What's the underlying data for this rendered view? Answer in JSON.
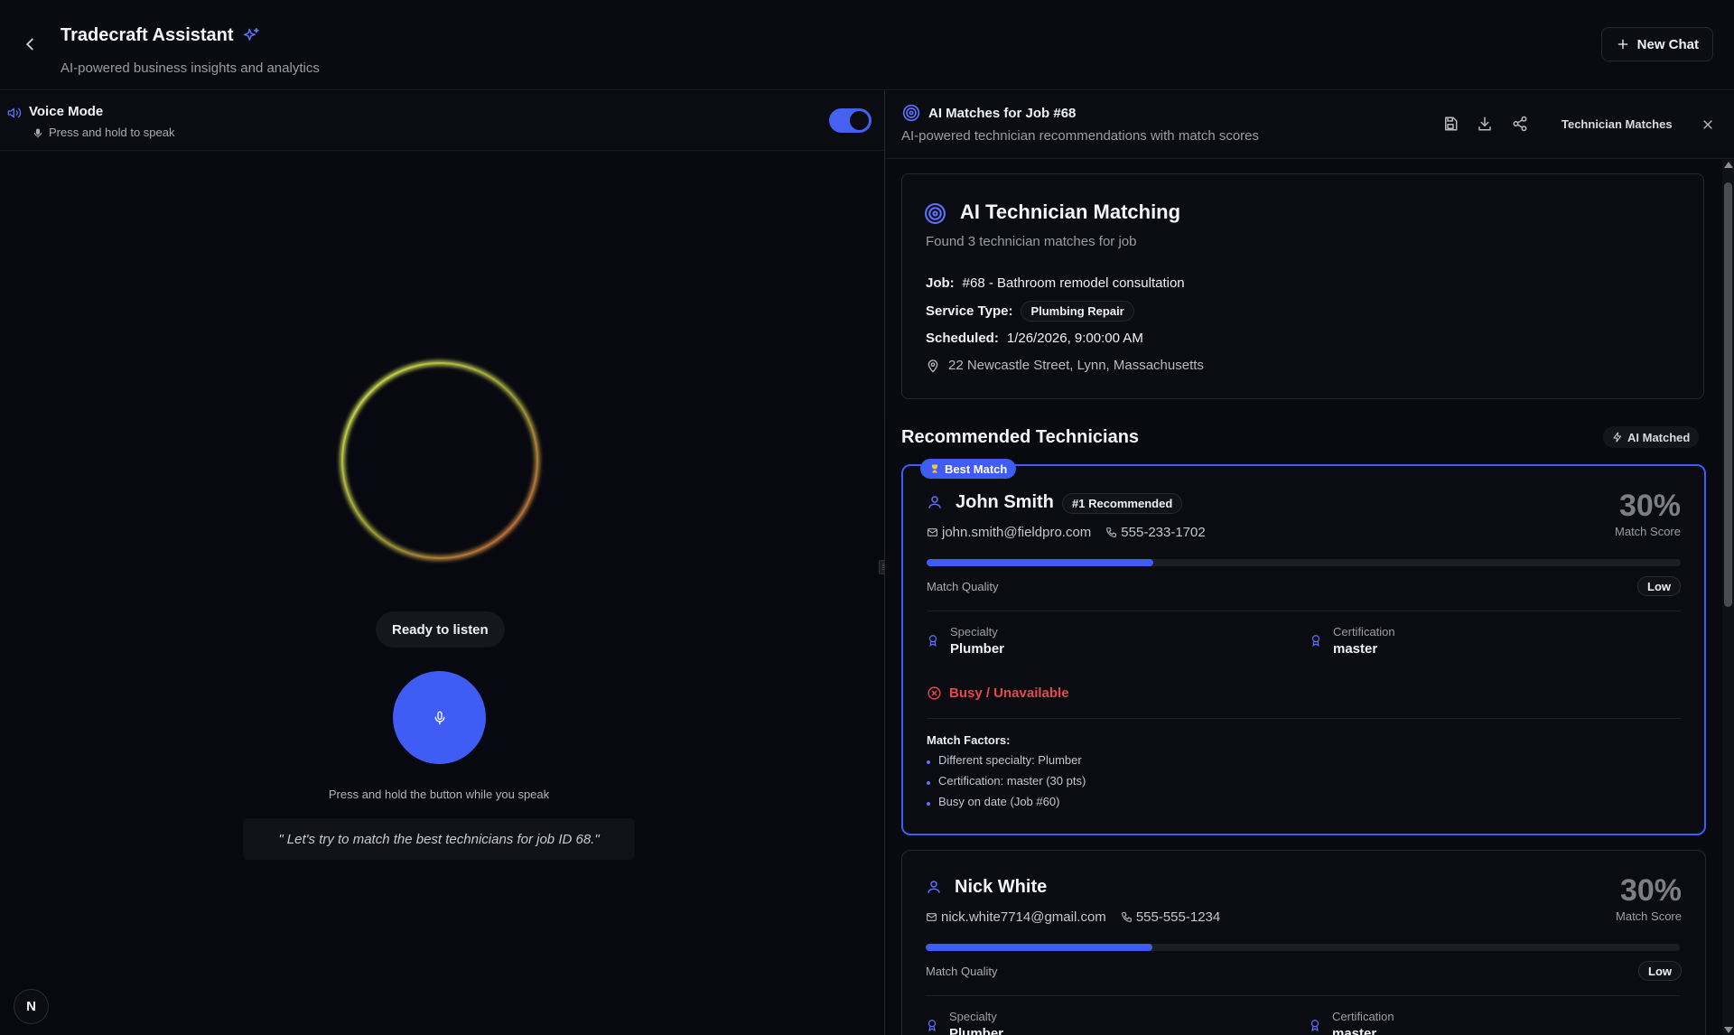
{
  "header": {
    "title": "Tradecraft Assistant",
    "subtitle": "AI-powered business insights and analytics",
    "new_chat_label": "New Chat"
  },
  "voice": {
    "mode_label": "Voice Mode",
    "hint": "Press and hold to speak",
    "toggle_on": true,
    "status": "Ready to listen",
    "press_hint": "Press and hold the button while you speak",
    "transcript": "\" Let's try to match the best technicians for job ID 68.\""
  },
  "panel": {
    "title": "AI Matches for Job #68",
    "subtitle": "AI-powered technician recommendations with match scores",
    "tab_label": "Technician Matches",
    "tools": [
      "save-icon",
      "download-icon",
      "share-icon"
    ]
  },
  "summary": {
    "title": "AI Technician Matching",
    "subtitle": "Found 3 technician matches for job",
    "job_label": "Job:",
    "job_value": "#68 - Bathroom remodel consultation",
    "service_label": "Service Type:",
    "service_value": "Plumbing Repair",
    "scheduled_label": "Scheduled:",
    "scheduled_value": "1/26/2026, 9:00:00 AM",
    "address": "22 Newcastle Street, Lynn, Massachusetts"
  },
  "recommended": {
    "title": "Recommended Technicians",
    "ai_badge": "AI Matched"
  },
  "technicians": [
    {
      "flag": "Best Match",
      "name": "John Smith",
      "badge": "#1 Recommended",
      "email": "john.smith@fieldpro.com",
      "phone": "555-233-1702",
      "score": "30%",
      "score_label": "Match Score",
      "match_quality_fraction": 0.3,
      "quality_label": "Match Quality",
      "quality_level": "Low",
      "specialty_label": "Specialty",
      "specialty": "Plumber",
      "certification_label": "Certification",
      "certification": "master",
      "availability": "Busy / Unavailable",
      "factors_title": "Match Factors:",
      "factors": [
        "Different specialty: Plumber",
        "Certification: master (30 pts)",
        "Busy on date (Job #60)"
      ]
    },
    {
      "name": "Nick White",
      "email": "nick.white7714@gmail.com",
      "phone": "555-555-1234",
      "score": "30%",
      "score_label": "Match Score",
      "match_quality_fraction": 0.3,
      "quality_label": "Match Quality",
      "quality_level": "Low",
      "specialty_label": "Specialty",
      "specialty": "Plumber",
      "certification_label": "Certification",
      "certification": "master"
    }
  ],
  "badge_letter": "N",
  "colors": {
    "accent": "#3f5cf5",
    "danger": "#e5484d",
    "background": "#07080d"
  }
}
